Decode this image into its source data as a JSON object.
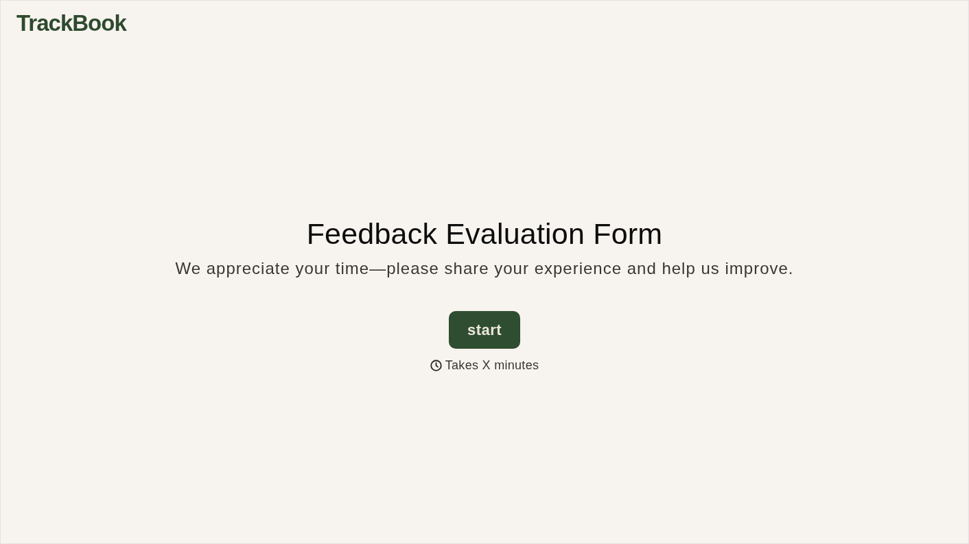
{
  "logo": {
    "text": "TrackBook"
  },
  "heading": "Feedback Evaluation Form",
  "subtitle": "We appreciate your time—please share your experience and help us improve.",
  "start_button": {
    "label": "start"
  },
  "duration": {
    "text": "Takes X minutes"
  }
}
